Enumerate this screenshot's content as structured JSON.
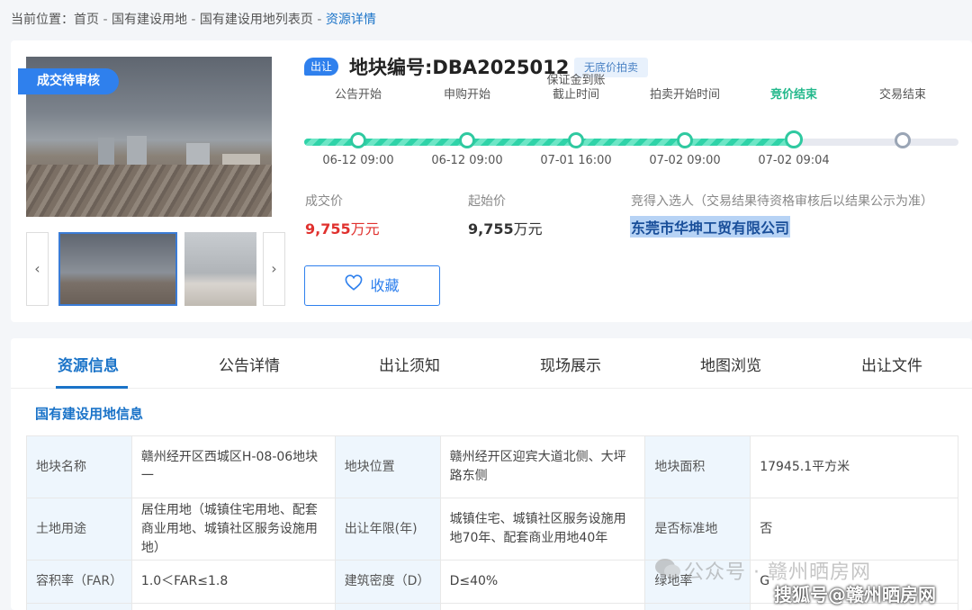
{
  "breadcrumb": {
    "prefix": "当前位置：",
    "items": [
      "首页",
      "国有建设用地",
      "国有建设用地列表页"
    ],
    "current": "资源详情",
    "separator": " - "
  },
  "listing": {
    "status_tag": "成交待审核",
    "transfer_badge": "出让",
    "title": "地块编号:DBA2025012",
    "auction_type": "无底价拍卖"
  },
  "timeline": {
    "steps": [
      {
        "label": "公告开始",
        "date": "06-12 09:00",
        "state": "done"
      },
      {
        "label": "申购开始",
        "date": "06-12 09:00",
        "state": "done"
      },
      {
        "label": "保证金到账\n截止时间",
        "date": "07-01 16:00",
        "state": "done"
      },
      {
        "label": "拍卖开始时间",
        "date": "07-02 09:00",
        "state": "done"
      },
      {
        "label": "竞价结束",
        "date": "07-02 09:04",
        "state": "active"
      },
      {
        "label": "交易结束",
        "date": "",
        "state": "pending"
      }
    ]
  },
  "prices": {
    "deal_label": "成交价",
    "deal_value": "9,755",
    "deal_unit": "万元",
    "start_label": "起始价",
    "start_value": "9,755",
    "start_unit": "万元",
    "winner_label": "竞得入选人（交易结果待资格审核后以结果公示为准）",
    "winner_name": "东莞市华坤工贸有限公司"
  },
  "favorite_button": "收藏",
  "tabs": [
    "资源信息",
    "公告详情",
    "出让须知",
    "现场展示",
    "地图浏览",
    "出让文件"
  ],
  "section_title": "国有建设用地信息",
  "info_table": {
    "rows": [
      [
        "地块名称",
        "赣州经开区西城区H-08-06地块一",
        "地块位置",
        "赣州经开区迎宾大道北侧、大坪路东侧",
        "地块面积",
        "17945.1平方米"
      ],
      [
        "土地用途",
        "居住用地（城镇住宅用地、配套商业用地、城镇社区服务设施用地）",
        "出让年限(年)",
        "城镇住宅、城镇社区服务设施用地70年、配套商业用地40年",
        "是否标准地",
        "否"
      ],
      [
        "容积率（FAR）",
        "1.0＜FAR≤1.8",
        "建筑密度（D）",
        "D≤40%",
        "绿地率",
        "G"
      ],
      [
        "",
        "",
        "",
        "",
        "",
        ""
      ]
    ]
  },
  "watermarks": {
    "line1": "公众号 · 赣州晒房网",
    "line2": "搜狐号@赣州晒房网"
  },
  "colors": {
    "accent": "#2f80ed",
    "deal_price": "#e0312e",
    "timeline_done": "#2fc9a0",
    "table_key_bg": "#eef6fd"
  }
}
